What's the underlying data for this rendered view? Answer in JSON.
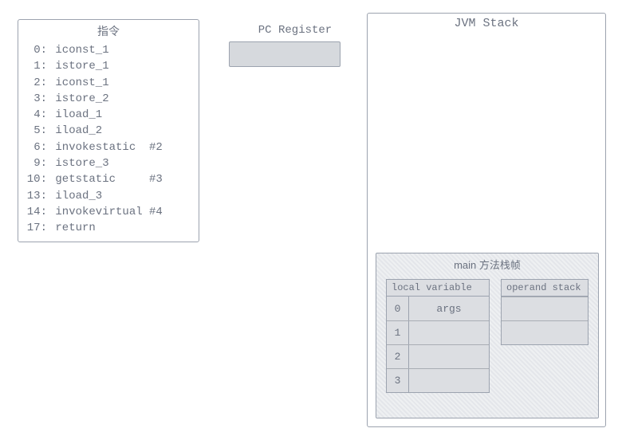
{
  "instructions": {
    "title": "指令",
    "items": [
      {
        "idx": "0",
        "op": "iconst_1",
        "arg": ""
      },
      {
        "idx": "1",
        "op": "istore_1",
        "arg": ""
      },
      {
        "idx": "2",
        "op": "iconst_1",
        "arg": ""
      },
      {
        "idx": "3",
        "op": "istore_2",
        "arg": ""
      },
      {
        "idx": "4",
        "op": "iload_1",
        "arg": ""
      },
      {
        "idx": "5",
        "op": "iload_2",
        "arg": ""
      },
      {
        "idx": "6",
        "op": "invokestatic",
        "arg": "#2"
      },
      {
        "idx": "9",
        "op": "istore_3",
        "arg": ""
      },
      {
        "idx": "10",
        "op": "getstatic",
        "arg": "#3"
      },
      {
        "idx": "13",
        "op": "iload_3",
        "arg": ""
      },
      {
        "idx": "14",
        "op": "invokevirtual",
        "arg": "#4"
      },
      {
        "idx": "17",
        "op": "return",
        "arg": ""
      }
    ]
  },
  "pc_register": {
    "label": "PC Register",
    "value": ""
  },
  "jvm_stack": {
    "title": "JVM Stack",
    "frame": {
      "title": "main 方法栈帧",
      "local_variable": {
        "header": "local variable",
        "rows": [
          {
            "idx": "0",
            "val": "args"
          },
          {
            "idx": "1",
            "val": ""
          },
          {
            "idx": "2",
            "val": ""
          },
          {
            "idx": "3",
            "val": ""
          }
        ]
      },
      "operand_stack": {
        "header": "operand stack",
        "rows": [
          {
            "val": ""
          },
          {
            "val": ""
          }
        ]
      }
    }
  }
}
